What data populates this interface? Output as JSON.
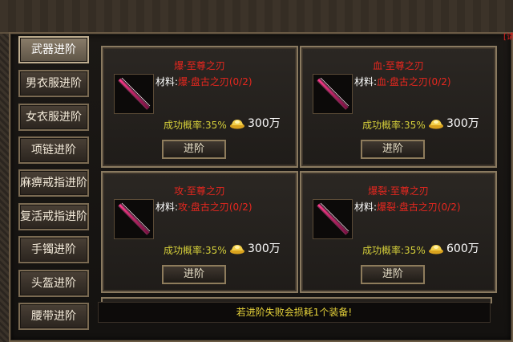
{
  "close_label": "[请",
  "sidebar": {
    "items": [
      {
        "label": "武器进阶",
        "active": true
      },
      {
        "label": "男衣服进阶",
        "active": false
      },
      {
        "label": "女衣服进阶",
        "active": false
      },
      {
        "label": "项链进阶",
        "active": false
      },
      {
        "label": "麻痹戒指进阶",
        "active": false
      },
      {
        "label": "复活戒指进阶",
        "active": false
      },
      {
        "label": "手镯进阶",
        "active": false
      },
      {
        "label": "头盔进阶",
        "active": false
      },
      {
        "label": "腰带进阶",
        "active": false
      }
    ]
  },
  "material_label": "材料:",
  "rate_label": "成功概率:",
  "advance_label": "进阶",
  "cards": [
    {
      "name": "爆·至尊之刃",
      "material": "爆·盘古之刃(0/2)",
      "rate": "35%",
      "price": "300万"
    },
    {
      "name": "血·至尊之刃",
      "material": "血·盘古之刃(0/2)",
      "rate": "35%",
      "price": "300万"
    },
    {
      "name": "攻·至尊之刃",
      "material": "攻·盘古之刃(0/2)",
      "rate": "35%",
      "price": "300万"
    },
    {
      "name": "爆裂·至尊之刃",
      "material": "爆裂·盘古之刃(0/2)",
      "rate": "35%",
      "price": "600万"
    }
  ],
  "notice": "若进阶失败会损耗1个装备!",
  "colors": {
    "item_name": "#e8271f",
    "rate": "#d4ce3a",
    "notice": "#e6d23a"
  },
  "icons": {
    "item": "blade-icon",
    "currency": "gold-ingot-icon"
  }
}
